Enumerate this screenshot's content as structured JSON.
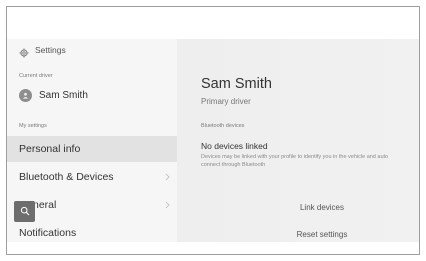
{
  "sidebar": {
    "title": "Settings",
    "current_driver_label": "Current driver",
    "driver_name": "Sam Smith",
    "my_settings_label": "My settings",
    "items": [
      {
        "label": "Personal info",
        "active": true
      },
      {
        "label": "Bluetooth & Devices",
        "active": false
      },
      {
        "label": "General",
        "active": false
      },
      {
        "label": "Notifications",
        "active": false
      }
    ]
  },
  "main": {
    "profile_name": "Sam Smith",
    "profile_role": "Primary driver",
    "bluetooth_label": "Bluetooth devices",
    "no_devices_title": "No devices linked",
    "no_devices_desc": "Devices may be linked with your profile to identify you in the vehicle and auto connect through Bluetooth",
    "link_devices_label": "Link devices",
    "reset_settings_label": "Reset settings"
  },
  "icons": {
    "settings": "gear-icon",
    "avatar": "person-icon",
    "search": "search-icon",
    "chevron": "chevron-right-icon"
  },
  "colors": {
    "sidebar_bg": "#f6f6f6",
    "active_item_bg": "#e2e2e2",
    "search_button_bg": "#6d6d6d"
  }
}
